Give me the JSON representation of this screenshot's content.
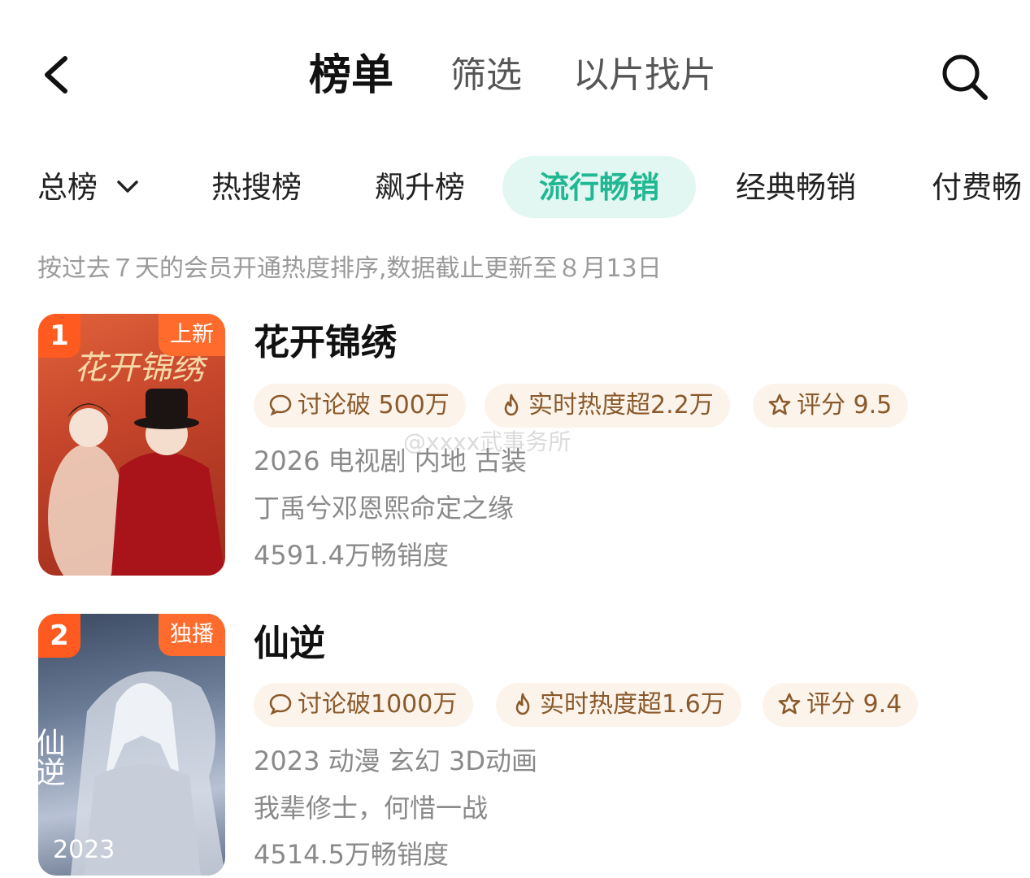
{
  "header": {
    "tabs": [
      "榜单",
      "筛选",
      "以片找片"
    ]
  },
  "categories": [
    "总榜",
    "热搜榜",
    "飙升榜",
    "流行畅销",
    "经典畅销",
    "付费畅"
  ],
  "description": "按过去７天的会员开通热度排序,数据截止更新至８月13日",
  "watermark": "@xxxx武事务所",
  "items": [
    {
      "rank": "1",
      "badge": "上新",
      "title": "花开锦绣",
      "chips": [
        "讨论破 500万",
        "实时热度超2.2万",
        "评分 9.5"
      ],
      "info": "2026 电视剧 内地 古装",
      "tagline": "丁禹兮邓恩熙命定之缘",
      "sales": "4591.4万畅销度"
    },
    {
      "rank": "2",
      "badge": "独播",
      "title": "仙逆",
      "poster_year": "2023",
      "chips": [
        "讨论破1000万",
        "实时热度超1.6万",
        "评分 9.4"
      ],
      "info": "2023 动漫 玄幻 3D动画",
      "tagline": "我辈修士，何惜一战",
      "sales": "4514.5万畅销度"
    }
  ],
  "colors": {
    "accent": "#1fb892",
    "accent_bg": "#e2f7f1",
    "rank_badge": "#ff5a1f",
    "chip_bg": "#fcf4eb",
    "chip_text": "#8a5a2c"
  }
}
